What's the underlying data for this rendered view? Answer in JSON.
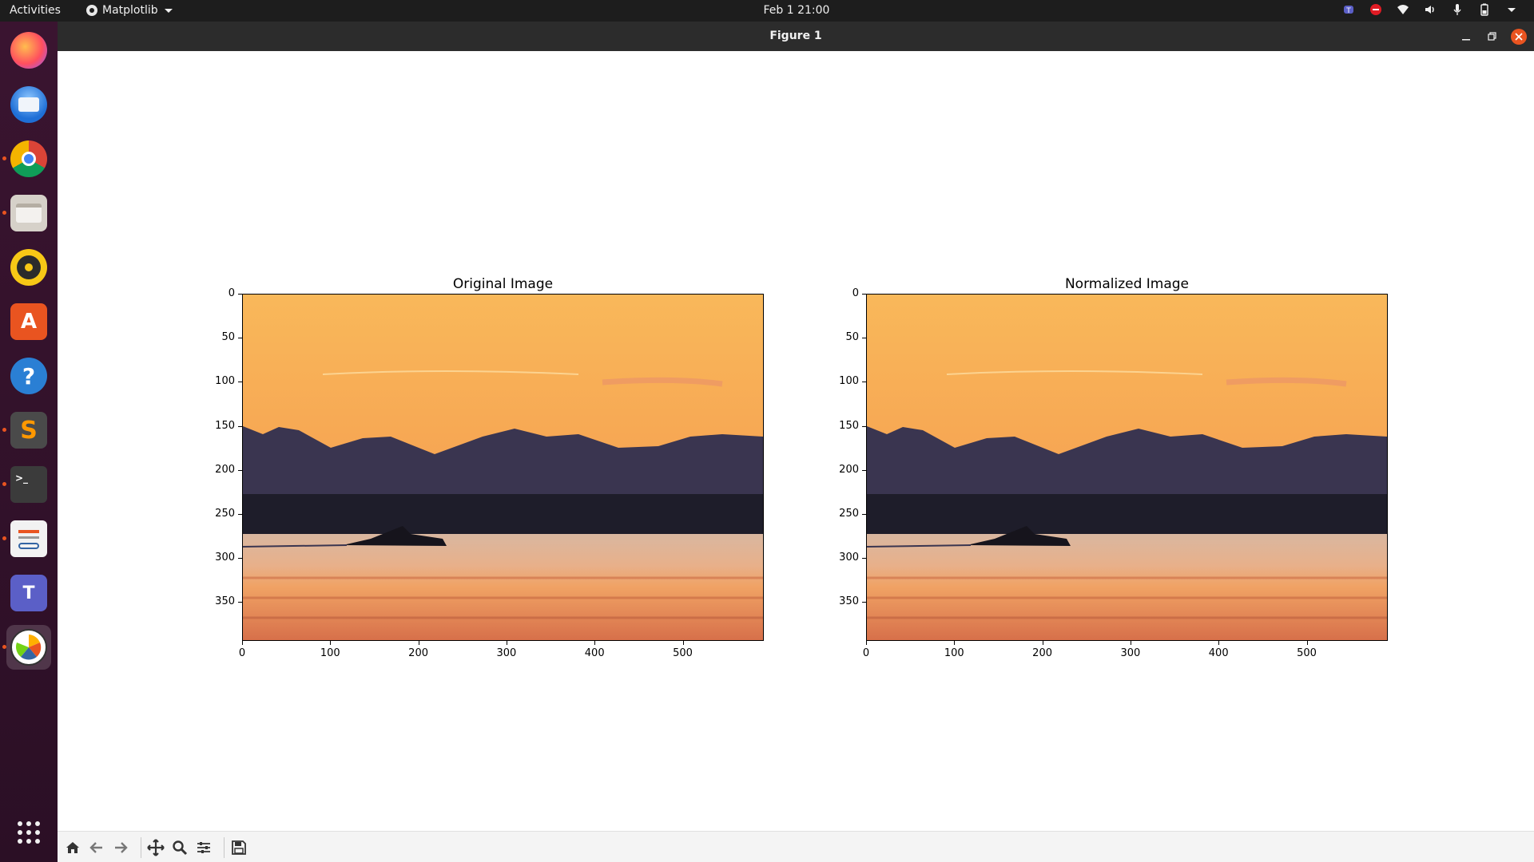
{
  "topbar": {
    "activities": "Activities",
    "app_menu": "Matplotlib",
    "clock": "Feb 1  21:00"
  },
  "dock": {
    "items": [
      "firefox",
      "thunderbird",
      "chrome",
      "files",
      "rhythmbox",
      "app-center",
      "help",
      "sublime-text",
      "terminal",
      "document-viewer",
      "teams-insiders",
      "matplotlib"
    ],
    "show_apps": "show-applications"
  },
  "window": {
    "title": "Figure 1"
  },
  "figure": {
    "subplots": [
      {
        "title": "Original Image",
        "xticks": [
          "0",
          "100",
          "200",
          "300",
          "400",
          "500"
        ],
        "yticks": [
          "0",
          "50",
          "100",
          "150",
          "200",
          "250",
          "300",
          "350"
        ]
      },
      {
        "title": "Normalized Image",
        "xticks": [
          "0",
          "100",
          "200",
          "300",
          "400",
          "500"
        ],
        "yticks": [
          "0",
          "50",
          "100",
          "150",
          "200",
          "250",
          "300",
          "350"
        ]
      }
    ]
  },
  "toolbar": {
    "buttons": [
      "home-icon",
      "back-arrow-icon",
      "forward-arrow-icon",
      "pan-icon",
      "zoom-icon",
      "configure-subplots-icon",
      "save-icon"
    ]
  },
  "colors": {
    "sky_top": "#f8b451",
    "sky_bottom": "#f0935d",
    "mountains": "#37324a",
    "water": "#e8a36a",
    "accent": "#e95420"
  }
}
